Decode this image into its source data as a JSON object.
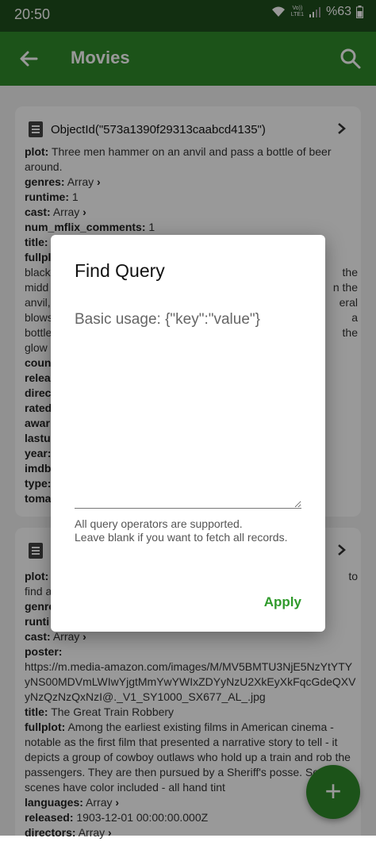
{
  "status_bar": {
    "time": "20:50",
    "volte_top": "Vo))",
    "volte_bottom": "LTE1",
    "battery": "%63"
  },
  "app_bar": {
    "title": "Movies"
  },
  "card1": {
    "id": "ObjectId(\"573a1390f29313caabcd4135\")",
    "plot_key": "plot:",
    "plot_val": "Three men hammer on an anvil and pass a bottle of beer around.",
    "genres_key": "genres:",
    "genres_val": "Array",
    "runtime_key": "runtime:",
    "runtime_val": "1",
    "cast_key": "cast:",
    "cast_val": "Array",
    "num_key": "num_mflix_comments:",
    "num_val": "1",
    "title_key": "title:",
    "fullplot_key": "fullpl",
    "fullplot_left": "black",
    "fullplot_right": "the",
    "line_midd": "midd",
    "line_midd_r": "n the",
    "line_anvil": "anvil,",
    "line_anvil_r": "eral",
    "line_blow": "blows",
    "line_blow_r": "a",
    "line_bottl": "bottle",
    "line_bottl_r": "the",
    "line_glow": "glow",
    "k_coun": "coun",
    "k_relea": "relea",
    "k_direc": "direc",
    "k_rated": "rated",
    "k_awar": "awar",
    "k_lastu": "lastu",
    "k_year": "year:",
    "k_imdb": "imdb",
    "k_type": "type:",
    "k_toma": "toma"
  },
  "card2": {
    "plot_key": "plot:",
    "plot_right": "to",
    "line_find": "find a",
    "k_genre": "genre",
    "k_runti": "runti",
    "cast_key": "cast:",
    "cast_val": "Array",
    "poster_key": "poster:",
    "poster_url": "https://m.media-amazon.com/images/M/MV5BMTU3NjE5NzYtYTYyNS00MDVmLWIwYjgtMmYwYWIxZDYyNzU2XkEyXkFqcGdeQXVyNzQzNzQxNzI@._V1_SY1000_SX677_AL_.jpg",
    "title_key": "title:",
    "title_val": "The Great Train Robbery",
    "fullplot_key": "fullplot:",
    "fullplot_val": "Among the earliest existing films in American cinema - notable as the first film that presented a narrative story to tell - it depicts a group of cowboy outlaws who hold up a train and rob the passengers. They are then pursued by a Sheriff's posse. Several scenes have color included - all hand tint",
    "languages_key": "languages:",
    "languages_val": "Array",
    "released_key": "released:",
    "released_val": "1903-12-01 00:00:00.000Z",
    "directors_key": "directors:",
    "directors_val": "Array"
  },
  "dialog": {
    "title": "Find Query",
    "input_placeholder": "Basic usage: {\"key\":\"value\"}",
    "input_value": "",
    "help_line1": "All query operators are supported.",
    "help_line2": "Leave blank if you want to fetch all records.",
    "apply_label": "Apply"
  },
  "fab": {
    "label": "+"
  },
  "colors": {
    "appbar": "#2f8a2b",
    "statusbar": "#1f4f1d",
    "accent": "#2f9a2b"
  }
}
